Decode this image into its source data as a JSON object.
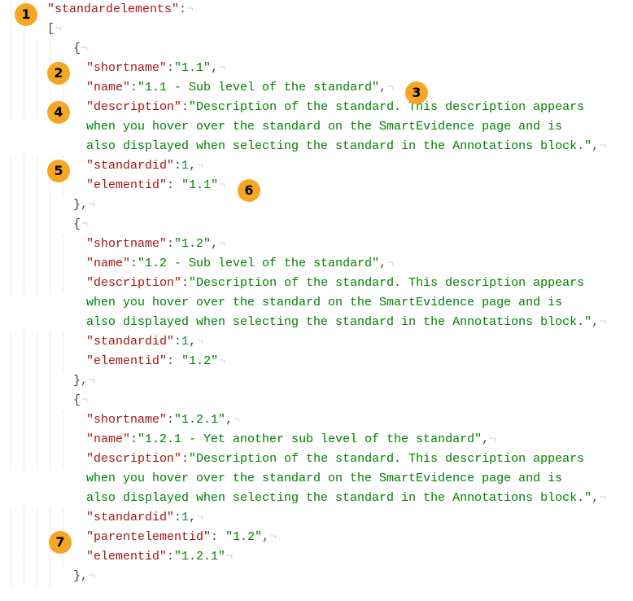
{
  "callouts": [
    "1",
    "2",
    "3",
    "4",
    "5",
    "6",
    "7"
  ],
  "symbols": {
    "pilcrow": "¬",
    "open_bracket": "[",
    "open_brace": "{",
    "close_brace_comma": "},",
    "colon": ":",
    "comma": ",",
    "space": " "
  },
  "toplevel_key": "\"standardelements\"",
  "keys": {
    "shortname": "\"shortname\"",
    "name": "\"name\"",
    "description": "\"description\"",
    "standardid": "\"standardid\"",
    "elementid": "\"elementid\"",
    "parentelementid": "\"parentelementid\""
  },
  "entries": [
    {
      "shortname": "\"1.1\"",
      "name": "\"1.1 - Sub level of the standard\"",
      "description_wrap": [
        "\"Description of the standard. This description appears",
        "when you hover over the standard on the SmartEvidence page and is",
        "also displayed when selecting the standard in the Annotations block.\""
      ],
      "standardid": "1",
      "elementid": "\"1.1\""
    },
    {
      "shortname": "\"1.2\"",
      "name": "\"1.2 - Sub level of the standard\"",
      "description_wrap": [
        "\"Description of the standard. This description appears",
        "when you hover over the standard on the SmartEvidence page and is",
        "also displayed when selecting the standard in the Annotations block.\""
      ],
      "standardid": "1",
      "elementid": "\"1.2\""
    },
    {
      "shortname": "\"1.2.1\"",
      "name": "\"1.2.1 - Yet another sub level of the standard\"",
      "description_wrap": [
        "\"Description of the standard. This description appears",
        "when you hover over the standard on the SmartEvidence page and is",
        "also displayed when selecting the standard in the Annotations block.\""
      ],
      "standardid": "1",
      "parentelementid": "\"1.2\"",
      "elementid": "\"1.2.1\""
    }
  ]
}
